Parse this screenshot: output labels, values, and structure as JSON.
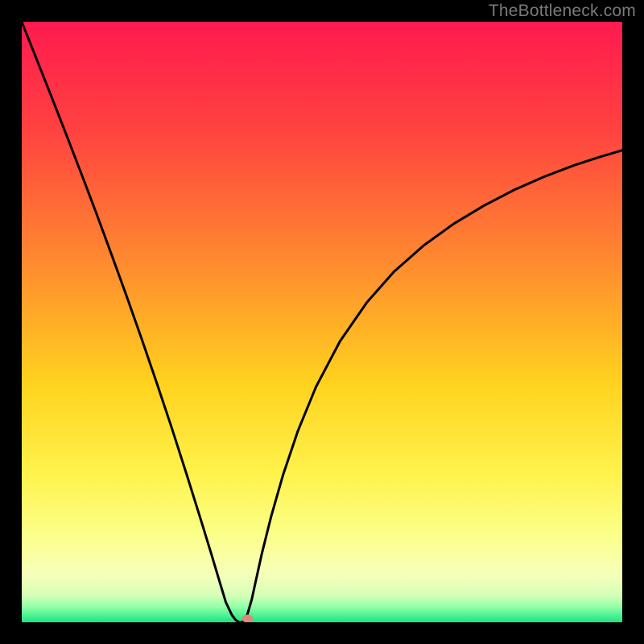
{
  "watermark": "TheBottleneck.com",
  "chart_data": {
    "type": "line",
    "title": "",
    "xlabel": "",
    "ylabel": "",
    "xlim": [
      0,
      100
    ],
    "ylim": [
      0,
      100
    ],
    "background_gradient_stops": [
      {
        "offset": 0.0,
        "color": "#ff1a4f"
      },
      {
        "offset": 0.18,
        "color": "#ff4240"
      },
      {
        "offset": 0.4,
        "color": "#ff8a2f"
      },
      {
        "offset": 0.6,
        "color": "#ffd21e"
      },
      {
        "offset": 0.75,
        "color": "#fff24a"
      },
      {
        "offset": 0.85,
        "color": "#fcff87"
      },
      {
        "offset": 0.92,
        "color": "#f6ffba"
      },
      {
        "offset": 0.955,
        "color": "#d6ffb8"
      },
      {
        "offset": 0.975,
        "color": "#8fffa8"
      },
      {
        "offset": 1.0,
        "color": "#17e582"
      }
    ],
    "series": [
      {
        "name": "bottleneck-curve",
        "x": [
          0.0,
          2.5,
          5.0,
          7.5,
          10.0,
          12.5,
          15.0,
          17.5,
          20.0,
          22.5,
          25.0,
          27.5,
          30.0,
          31.5,
          33.0,
          34.0,
          35.0,
          35.6,
          36.2,
          36.6,
          37.0,
          37.6,
          38.3,
          39.0,
          40.0,
          41.5,
          43.5,
          46.0,
          49.0,
          53.0,
          57.5,
          62.0,
          67.0,
          72.0,
          77.0,
          82.0,
          87.0,
          92.0,
          96.0,
          100.0
        ],
        "y": [
          100.0,
          93.7,
          87.4,
          81.0,
          74.5,
          67.9,
          61.1,
          54.2,
          47.1,
          39.8,
          32.3,
          24.5,
          16.5,
          11.6,
          6.6,
          3.3,
          1.2,
          0.4,
          0.0,
          0.0,
          0.2,
          1.4,
          3.8,
          7.0,
          11.5,
          17.5,
          24.5,
          31.9,
          39.2,
          46.8,
          53.3,
          58.4,
          62.8,
          66.4,
          69.4,
          72.0,
          74.2,
          76.1,
          77.4,
          78.6
        ]
      }
    ],
    "marker": {
      "x": 37.6,
      "y": 0.6,
      "color": "#d98a7a"
    }
  }
}
